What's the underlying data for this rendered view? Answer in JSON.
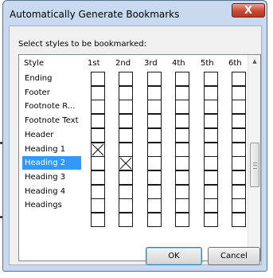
{
  "window": {
    "title": "Automatically Generate Bookmarks",
    "close_glyph": "X"
  },
  "dialog": {
    "prompt": "Select styles to be bookmarked:",
    "columns": [
      "Style",
      "1st",
      "2nd",
      "3rd",
      "4th",
      "5th",
      "6th"
    ],
    "rows": [
      {
        "label": "Ending",
        "checked": [
          false,
          false,
          false,
          false,
          false,
          false
        ],
        "selected": false
      },
      {
        "label": "Footer",
        "checked": [
          false,
          false,
          false,
          false,
          false,
          false
        ],
        "selected": false
      },
      {
        "label": "Footnote R...",
        "checked": [
          false,
          false,
          false,
          false,
          false,
          false
        ],
        "selected": false
      },
      {
        "label": "Footnote Text",
        "checked": [
          false,
          false,
          false,
          false,
          false,
          false
        ],
        "selected": false
      },
      {
        "label": "Header",
        "checked": [
          false,
          false,
          false,
          false,
          false,
          false
        ],
        "selected": false
      },
      {
        "label": "Heading 1",
        "checked": [
          true,
          false,
          false,
          false,
          false,
          false
        ],
        "selected": false
      },
      {
        "label": "Heading 2",
        "checked": [
          false,
          true,
          false,
          false,
          false,
          false
        ],
        "selected": true
      },
      {
        "label": "Heading 3",
        "checked": [
          false,
          false,
          false,
          false,
          false,
          false
        ],
        "selected": false
      },
      {
        "label": "Heading 4",
        "checked": [
          false,
          false,
          false,
          false,
          false,
          false
        ],
        "selected": false
      },
      {
        "label": "Headings",
        "checked": [
          false,
          false,
          false,
          false,
          false,
          false
        ],
        "selected": false
      }
    ],
    "ok_label": "OK",
    "cancel_label": "Cancel"
  },
  "colors": {
    "selection": "#3399ff",
    "frame": "#c9daf0",
    "close_button": "#c84a35"
  }
}
